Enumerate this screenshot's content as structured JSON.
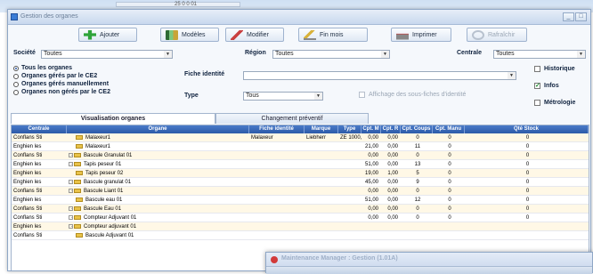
{
  "background": {
    "value": "25 0 0 01"
  },
  "window": {
    "title": "Gestion des organes",
    "controls": [
      "_",
      "□"
    ]
  },
  "toolbar": {
    "add": "Ajouter",
    "models": "Modèles",
    "edit": "Modifier",
    "end_month": "Fin mois",
    "print": "Imprimer",
    "refresh": "Rafraîchir"
  },
  "filters": {
    "societe_label": "Société",
    "societe_value": "Toutes",
    "region_label": "Région",
    "region_value": "Toutes",
    "centrale_label": "Centrale",
    "centrale_value": "Toutes",
    "fiche_label": "Fiche identité",
    "fiche_value": "",
    "type_label": "Type",
    "type_value": "Tous",
    "affichage_label": "Affichage des sous-fiches d'identité"
  },
  "radios": [
    {
      "label": "Tous  les organes",
      "selected": true
    },
    {
      "label": "Organes gérés par le CE2",
      "selected": false
    },
    {
      "label": "Organes gérés manuellement",
      "selected": false
    },
    {
      "label": "Organes non gérés par le CE2",
      "selected": false
    }
  ],
  "checks": {
    "historique": {
      "label": "Historique",
      "checked": false
    },
    "infos": {
      "label": "Infos",
      "checked": true
    },
    "metrologie": {
      "label": "Métrologie",
      "checked": false
    }
  },
  "tabs": [
    "Visualisation organes",
    "Changement préventif"
  ],
  "grid": {
    "columns": [
      "Centrale",
      "Organe",
      "Fiche identité",
      "Marque",
      "Type",
      "Cpt. M",
      "Cpt. R",
      "Cpt. Coups",
      "Cpt. Manu",
      "Qté Stock"
    ],
    "rows": [
      [
        "Conflans Sti",
        "",
        "Malaxeur1",
        "Malaxeur",
        "Liebherr",
        "ZE 1000,",
        "0,00",
        "0,00",
        "0",
        "0",
        "0"
      ],
      [
        "Enghien les",
        "",
        "Malaxeur1",
        "",
        "",
        "",
        "21,00",
        "0,00",
        "11",
        "0",
        "0"
      ],
      [
        "Conflans Sti",
        "+",
        "Bascule Granulat 01",
        "",
        "",
        "",
        "0,00",
        "0,00",
        "0",
        "0",
        "0"
      ],
      [
        "Enghien les",
        "+",
        "Tapis peseur 01",
        "",
        "",
        "",
        "51,00",
        "0,00",
        "13",
        "0",
        "0"
      ],
      [
        "Enghien les",
        "",
        "Tapis peseur 02",
        "",
        "",
        "",
        "19,00",
        "1,00",
        "5",
        "0",
        "0"
      ],
      [
        "Enghien les",
        "+",
        "Bascule granulat 01",
        "",
        "",
        "",
        "45,00",
        "0,00",
        "9",
        "0",
        "0"
      ],
      [
        "Conflans Sti",
        "+",
        "Bascule Liant 01",
        "",
        "",
        "",
        "0,00",
        "0,00",
        "0",
        "0",
        "0"
      ],
      [
        "Enghien les",
        "",
        "Bascule eau 01",
        "",
        "",
        "",
        "51,00",
        "0,00",
        "12",
        "0",
        "0"
      ],
      [
        "Conflans Sti",
        "+",
        "Bascule Eau 01",
        "",
        "",
        "",
        "0,00",
        "0,00",
        "0",
        "0",
        "0"
      ],
      [
        "Conflans Sti",
        "+",
        "Compteur Adjuvant 01",
        "",
        "",
        "",
        "0,00",
        "0,00",
        "0",
        "0",
        "0"
      ],
      [
        "Enghien les",
        "+",
        "Compteur adjuvant 01",
        "",
        "",
        "",
        "",
        "",
        "",
        "",
        ""
      ],
      [
        "Conflans Sti",
        "",
        "Bascule Adjuvant 01",
        "",
        "",
        "",
        "",
        "",
        "",
        "",
        ""
      ]
    ]
  },
  "popup": {
    "title": "Maintenance Manager : Gestion (1.01A)"
  }
}
